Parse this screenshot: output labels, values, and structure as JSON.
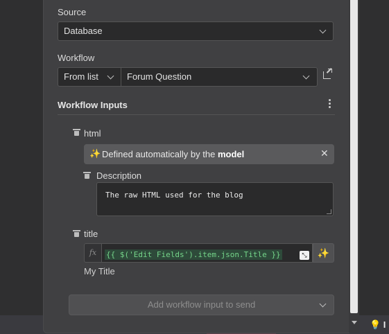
{
  "source": {
    "label": "Source",
    "value": "Database"
  },
  "workflow": {
    "label": "Workflow",
    "mode": "From list",
    "selected": "Forum Question"
  },
  "inputs": {
    "section_title": "Workflow Inputs",
    "html": {
      "name": "html",
      "auto_text_prefix": "Defined automatically by the",
      "auto_text_bold": "model",
      "description_label": "Description",
      "description_value": "The raw HTML used for the blog"
    },
    "title": {
      "name": "title",
      "fx_label": "fx",
      "expression": "{{ $('Edit Fields').item.json.Title }}",
      "resolved_value": "My Title"
    }
  },
  "add_input_button": "Add workflow input to send",
  "icons": {
    "auto": "sparkle-icon",
    "close": "close-icon",
    "trash": "trash-icon",
    "external": "external-link-icon",
    "kebab": "kebab-menu-icon",
    "ai": "ai-sparkle-icon",
    "expand": "expand-icon"
  }
}
